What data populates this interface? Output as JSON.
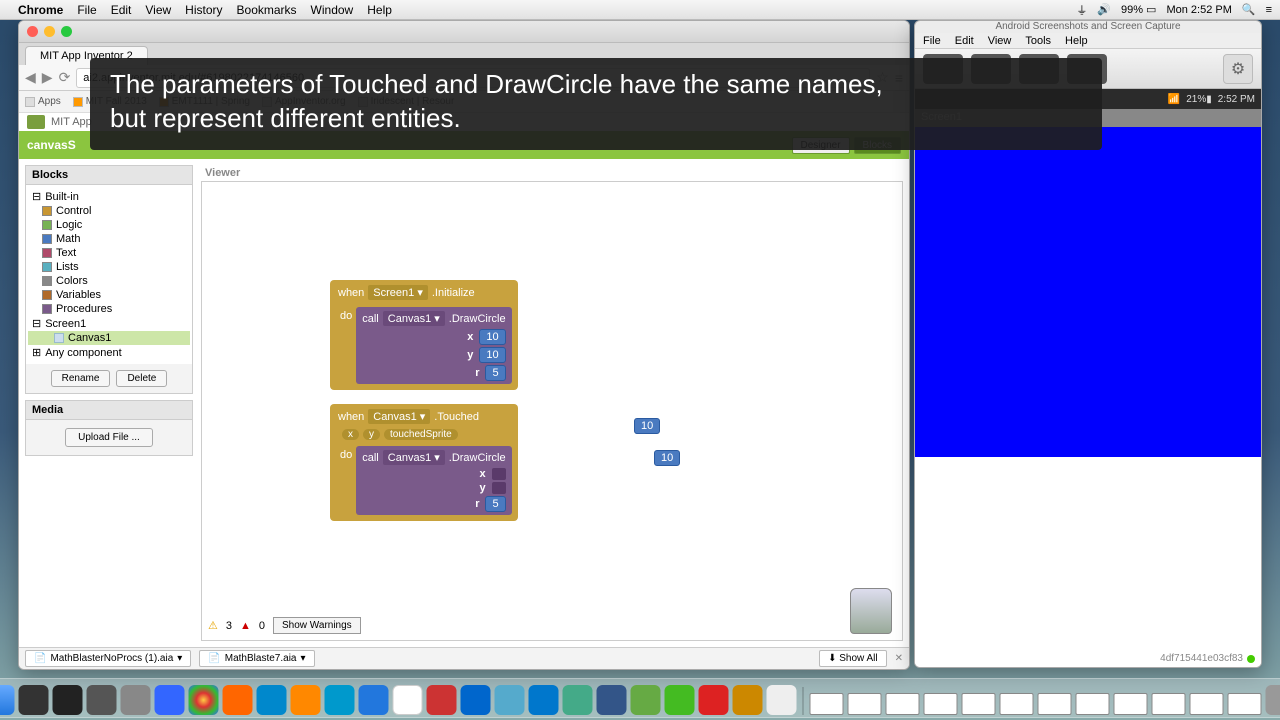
{
  "mac_menu": {
    "app": "Chrome",
    "items": [
      "File",
      "Edit",
      "View",
      "History",
      "Bookmarks",
      "Window",
      "Help"
    ],
    "battery": "99%",
    "time": "Mon 2:52 PM"
  },
  "chrome": {
    "tab_title": "MIT App Inventor 2",
    "url": "ai2.appinventor.mit.edu/#6198022174146560",
    "bookmarks": [
      "Apps",
      "MIT Fall 2013",
      "EMT1111 | Spring",
      "AppInventor.org",
      "Iridescent | Resour"
    ]
  },
  "ai": {
    "header": "MIT App",
    "project_bar": "canvasS",
    "designer_btn": "Designer",
    "blocks_btn": "Blocks",
    "blocks_panel_title": "Blocks",
    "builtin_label": "Built-in",
    "categories": [
      {
        "label": "Control",
        "color": "#c89632"
      },
      {
        "label": "Logic",
        "color": "#77b255"
      },
      {
        "label": "Math",
        "color": "#4a7ac0"
      },
      {
        "label": "Text",
        "color": "#b04a6a"
      },
      {
        "label": "Lists",
        "color": "#5ab0c0"
      },
      {
        "label": "Colors",
        "color": "#888"
      },
      {
        "label": "Variables",
        "color": "#b06a2a"
      },
      {
        "label": "Procedures",
        "color": "#7a5a8a"
      }
    ],
    "screen_item": "Screen1",
    "canvas_item": "Canvas1",
    "any_component": "Any component",
    "rename_btn": "Rename",
    "delete_btn": "Delete",
    "media_title": "Media",
    "upload_btn": "Upload File ...",
    "viewer_title": "Viewer",
    "warnings_count": "3",
    "errors_count": "0",
    "show_warnings_btn": "Show Warnings"
  },
  "blocks": {
    "b1": {
      "when": "when",
      "component": "Screen1",
      "event": ".Initialize",
      "do": "do",
      "call": "call",
      "call_component": "Canvas1",
      "method": ".DrawCircle",
      "slots": {
        "x": "x",
        "y": "y",
        "r": "r"
      },
      "vals": {
        "x": "10",
        "y": "10",
        "r": "5"
      }
    },
    "b2": {
      "when": "when",
      "component": "Canvas1",
      "event": ".Touched",
      "params": [
        "x",
        "y",
        "touchedSprite"
      ],
      "do": "do",
      "call": "call",
      "call_component": "Canvas1",
      "method": ".DrawCircle",
      "slots": {
        "x": "x",
        "y": "y",
        "r": "r"
      },
      "vals": {
        "r": "5"
      }
    },
    "loose": {
      "n1": "10",
      "n2": "10"
    }
  },
  "downloads": {
    "f1": "MathBlasterNoProcs (1).aia",
    "f2": "MathBlaste7.aia",
    "show_all": "Show All"
  },
  "tool": {
    "title": "Android Screenshots and Screen Capture",
    "menu": [
      "File",
      "Edit",
      "View",
      "Tools",
      "Help"
    ],
    "phone_time": "2:52 PM",
    "phone_battery": "21%",
    "screen_title": "Screen1",
    "device_id": "4df715441e03cf83"
  },
  "caption": {
    "line1": "The parameters of Touched and DrawCircle have the same names,",
    "line2": "but represent different entities."
  }
}
